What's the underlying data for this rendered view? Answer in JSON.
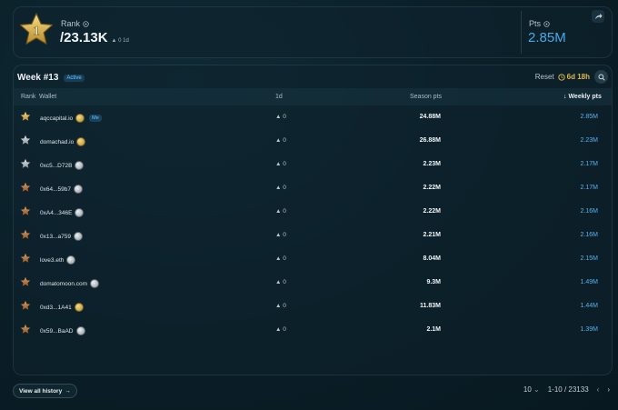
{
  "summary": {
    "rank_label": "Rank",
    "rank_value": "/23.13K",
    "rank_delta": "▲ 0 1d",
    "pts_label": "Pts",
    "pts_value": "2.85M",
    "badge_number": "1"
  },
  "board": {
    "title": "Week #13",
    "status": "Active",
    "reset_label": "Reset",
    "reset_time": "6d 18h",
    "columns": {
      "rank": "Rank",
      "wallet": "Wallet",
      "d1": "1d",
      "season": "Season pts",
      "weekly": "Weekly pts"
    },
    "rows": [
      {
        "tier": "gold",
        "wallet": "aqccapital.io",
        "coin": "gold",
        "me": "Me",
        "d1": "▲ 0",
        "season": "24.88M",
        "weekly": "2.85M"
      },
      {
        "tier": "silver",
        "wallet": "domachad.io",
        "coin": "gold",
        "me": "",
        "d1": "▲ 0",
        "season": "26.88M",
        "weekly": "2.23M"
      },
      {
        "tier": "silver",
        "wallet": "0xc5...D72B",
        "coin": "silver",
        "me": "",
        "d1": "▲ 0",
        "season": "2.23M",
        "weekly": "2.17M"
      },
      {
        "tier": "bronze",
        "wallet": "0x64...59b7",
        "coin": "silver",
        "me": "",
        "d1": "▲ 0",
        "season": "2.22M",
        "weekly": "2.17M"
      },
      {
        "tier": "bronze",
        "wallet": "0xA4...346E",
        "coin": "silver",
        "me": "",
        "d1": "▲ 0",
        "season": "2.22M",
        "weekly": "2.16M"
      },
      {
        "tier": "bronze",
        "wallet": "0x13...a759",
        "coin": "silver",
        "me": "",
        "d1": "▲ 0",
        "season": "2.21M",
        "weekly": "2.16M"
      },
      {
        "tier": "bronze",
        "wallet": "love3.eth",
        "coin": "silver",
        "me": "",
        "d1": "▲ 0",
        "season": "8.04M",
        "weekly": "2.15M"
      },
      {
        "tier": "bronze",
        "wallet": "domatomoon.com",
        "coin": "silver",
        "me": "",
        "d1": "▲ 0",
        "season": "9.3M",
        "weekly": "1.49M"
      },
      {
        "tier": "bronze",
        "wallet": "0xd3...1A41",
        "coin": "gold",
        "me": "",
        "d1": "▲ 0",
        "season": "11.83M",
        "weekly": "1.44M"
      },
      {
        "tier": "bronze",
        "wallet": "0x59...BaAD",
        "coin": "silver",
        "me": "",
        "d1": "▲ 0",
        "season": "2.1M",
        "weekly": "1.39M"
      }
    ]
  },
  "footer": {
    "history_label": "View all history",
    "page_size": "10",
    "range": "1-10 / 23133"
  },
  "colors": {
    "accent": "#4aa8e6",
    "timer": "#e2b74a",
    "gold": "#d9b04a",
    "silver": "#b9c1c6",
    "bronze": "#b06d3c"
  }
}
